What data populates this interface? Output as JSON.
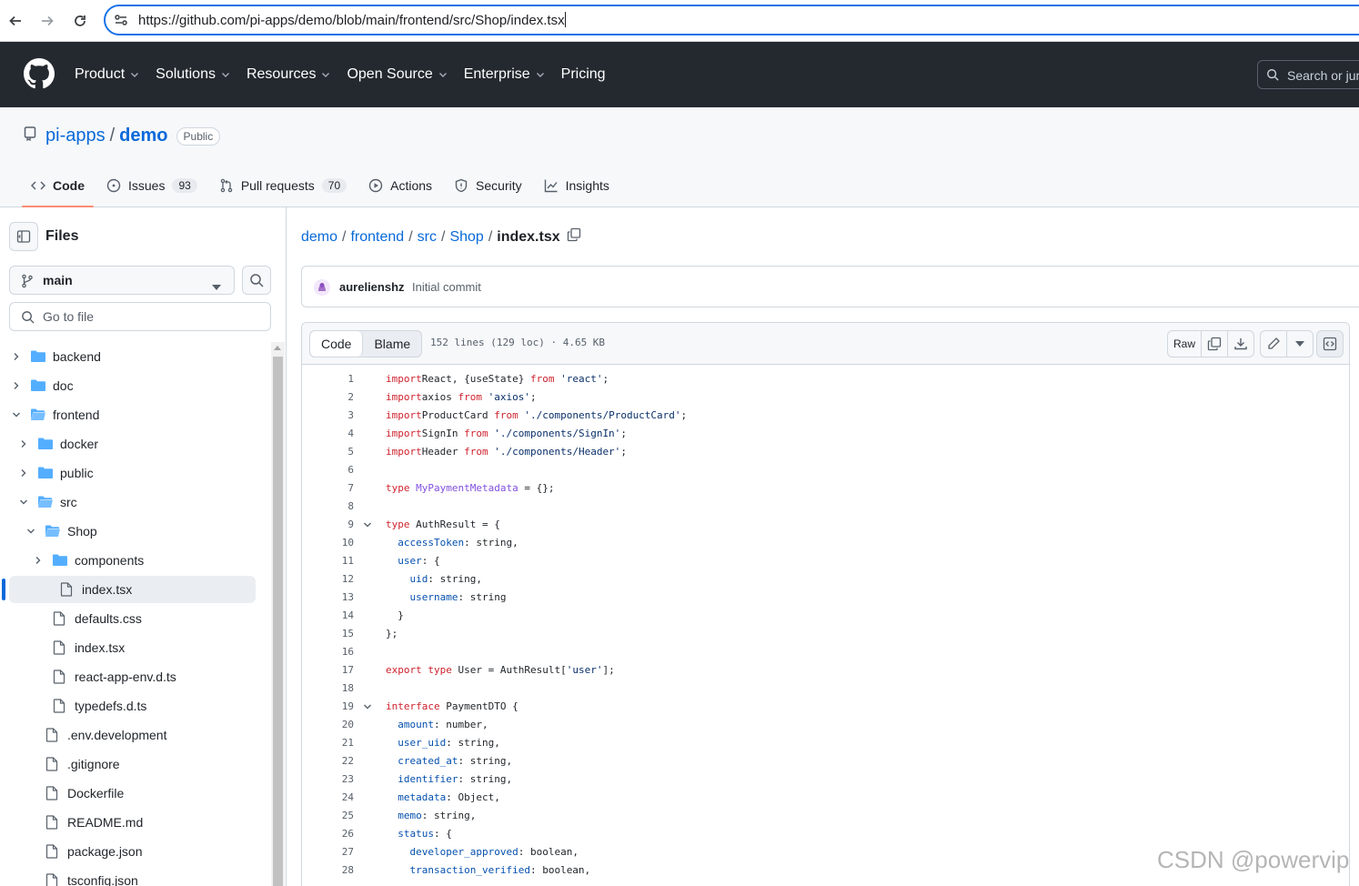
{
  "browser": {
    "url": "https://github.com/pi-apps/demo/blob/main/frontend/src/Shop/index.tsx"
  },
  "gh_header": {
    "nav": [
      "Product",
      "Solutions",
      "Resources",
      "Open Source",
      "Enterprise",
      "Pricing"
    ],
    "nav_has_dropdown": [
      true,
      true,
      true,
      true,
      true,
      false
    ],
    "search_placeholder": "Search or jump to..."
  },
  "repo": {
    "owner": "pi-apps",
    "separator": "/",
    "name": "demo",
    "visibility": "Public",
    "tabs": [
      {
        "label": "Code",
        "icon": "code-icon",
        "selected": true
      },
      {
        "label": "Issues",
        "icon": "issue-icon",
        "count": "93"
      },
      {
        "label": "Pull requests",
        "icon": "pull-request-icon",
        "count": "70"
      },
      {
        "label": "Actions",
        "icon": "play-icon"
      },
      {
        "label": "Security",
        "icon": "shield-icon"
      },
      {
        "label": "Insights",
        "icon": "graph-icon"
      }
    ]
  },
  "sidebar": {
    "title": "Files",
    "branch": "main",
    "goto_placeholder": "Go to file",
    "tree": [
      {
        "label": "backend",
        "type": "folder",
        "depth": 0,
        "expanded": false
      },
      {
        "label": "doc",
        "type": "folder",
        "depth": 0,
        "expanded": false
      },
      {
        "label": "frontend",
        "type": "folder",
        "depth": 0,
        "expanded": true
      },
      {
        "label": "docker",
        "type": "folder",
        "depth": 1,
        "expanded": false
      },
      {
        "label": "public",
        "type": "folder",
        "depth": 1,
        "expanded": false
      },
      {
        "label": "src",
        "type": "folder",
        "depth": 1,
        "expanded": true
      },
      {
        "label": "Shop",
        "type": "folder",
        "depth": 2,
        "expanded": true
      },
      {
        "label": "components",
        "type": "folder",
        "depth": 3,
        "expanded": false
      },
      {
        "label": "index.tsx",
        "type": "file",
        "depth": 3,
        "active": true
      },
      {
        "label": "defaults.css",
        "type": "file",
        "depth": 2
      },
      {
        "label": "index.tsx",
        "type": "file",
        "depth": 2
      },
      {
        "label": "react-app-env.d.ts",
        "type": "file",
        "depth": 2
      },
      {
        "label": "typedefs.d.ts",
        "type": "file",
        "depth": 2
      },
      {
        "label": ".env.development",
        "type": "file",
        "depth": 1
      },
      {
        "label": ".gitignore",
        "type": "file",
        "depth": 1
      },
      {
        "label": "Dockerfile",
        "type": "file",
        "depth": 1
      },
      {
        "label": "README.md",
        "type": "file",
        "depth": 1
      },
      {
        "label": "package.json",
        "type": "file",
        "depth": 1
      },
      {
        "label": "tsconfig.json",
        "type": "file",
        "depth": 1
      }
    ]
  },
  "breadcrumb": {
    "parts": [
      "demo",
      "frontend",
      "src",
      "Shop"
    ],
    "current": "index.tsx"
  },
  "commit": {
    "author": "aurelienshz",
    "message": "Initial commit"
  },
  "file": {
    "tab_code": "Code",
    "tab_blame": "Blame",
    "meta": "152 lines (129 loc) · 4.65 KB",
    "raw_label": "Raw",
    "lines": [
      {
        "n": "1",
        "t": [
          [
            "kw",
            "import"
          ],
          [
            "",
            "React, {useState} "
          ],
          [
            "kw",
            "from"
          ],
          [
            "str",
            " 'react'"
          ],
          [
            "",
            ";"
          ]
        ]
      },
      {
        "n": "2",
        "t": [
          [
            "kw",
            "import"
          ],
          [
            "",
            "axios "
          ],
          [
            "kw",
            "from"
          ],
          [
            "str",
            " 'axios'"
          ],
          [
            "",
            ";"
          ]
        ]
      },
      {
        "n": "3",
        "t": [
          [
            "kw",
            "import"
          ],
          [
            "",
            "ProductCard "
          ],
          [
            "kw",
            "from"
          ],
          [
            "str",
            " './components/ProductCard'"
          ],
          [
            "",
            ";"
          ]
        ]
      },
      {
        "n": "4",
        "t": [
          [
            "kw",
            "import"
          ],
          [
            "",
            "SignIn "
          ],
          [
            "kw",
            "from"
          ],
          [
            "str",
            " './components/SignIn'"
          ],
          [
            "",
            ";"
          ]
        ]
      },
      {
        "n": "5",
        "t": [
          [
            "kw",
            "import"
          ],
          [
            "",
            "Header "
          ],
          [
            "kw",
            "from"
          ],
          [
            "str",
            " './components/Header'"
          ],
          [
            "",
            ";"
          ]
        ]
      },
      {
        "n": "6",
        "t": []
      },
      {
        "n": "7",
        "t": [
          [
            "kw",
            "type"
          ],
          [
            "fn",
            " MyPaymentMetadata"
          ],
          [
            "",
            " = {};"
          ]
        ]
      },
      {
        "n": "8",
        "t": []
      },
      {
        "n": "9",
        "fold": true,
        "t": [
          [
            "kw",
            "type"
          ],
          [
            "",
            " AuthResult = {"
          ]
        ]
      },
      {
        "n": "10",
        "t": [
          [
            "",
            "  "
          ],
          [
            "prop",
            "accessToken"
          ],
          [
            "",
            ": string,"
          ]
        ]
      },
      {
        "n": "11",
        "t": [
          [
            "",
            "  "
          ],
          [
            "prop",
            "user"
          ],
          [
            "",
            ": {"
          ]
        ]
      },
      {
        "n": "12",
        "t": [
          [
            "",
            "    "
          ],
          [
            "prop",
            "uid"
          ],
          [
            "",
            ": string,"
          ]
        ]
      },
      {
        "n": "13",
        "t": [
          [
            "",
            "    "
          ],
          [
            "prop",
            "username"
          ],
          [
            "",
            ": string"
          ]
        ]
      },
      {
        "n": "14",
        "t": [
          [
            "",
            "  }"
          ]
        ]
      },
      {
        "n": "15",
        "t": [
          [
            "",
            "};"
          ]
        ]
      },
      {
        "n": "16",
        "t": []
      },
      {
        "n": "17",
        "t": [
          [
            "kw",
            "export"
          ],
          [
            "",
            ""
          ],
          [
            "kw",
            " type"
          ],
          [
            "",
            " User = AuthResult["
          ],
          [
            "str",
            "'user'"
          ],
          [
            "",
            "];"
          ]
        ]
      },
      {
        "n": "18",
        "t": []
      },
      {
        "n": "19",
        "fold": true,
        "t": [
          [
            "kw",
            "interface"
          ],
          [
            "",
            " PaymentDTO {"
          ]
        ]
      },
      {
        "n": "20",
        "t": [
          [
            "",
            "  "
          ],
          [
            "prop",
            "amount"
          ],
          [
            "",
            ": number,"
          ]
        ]
      },
      {
        "n": "21",
        "t": [
          [
            "",
            "  "
          ],
          [
            "prop",
            "user_uid"
          ],
          [
            "",
            ": string,"
          ]
        ]
      },
      {
        "n": "22",
        "t": [
          [
            "",
            "  "
          ],
          [
            "prop",
            "created_at"
          ],
          [
            "",
            ": string,"
          ]
        ]
      },
      {
        "n": "23",
        "t": [
          [
            "",
            "  "
          ],
          [
            "prop",
            "identifier"
          ],
          [
            "",
            ": string,"
          ]
        ]
      },
      {
        "n": "24",
        "t": [
          [
            "",
            "  "
          ],
          [
            "prop",
            "metadata"
          ],
          [
            "",
            ": Object,"
          ]
        ]
      },
      {
        "n": "25",
        "t": [
          [
            "",
            "  "
          ],
          [
            "prop",
            "memo"
          ],
          [
            "",
            ": string,"
          ]
        ]
      },
      {
        "n": "26",
        "t": [
          [
            "",
            "  "
          ],
          [
            "prop",
            "status"
          ],
          [
            "",
            ": {"
          ]
        ]
      },
      {
        "n": "27",
        "t": [
          [
            "",
            "    "
          ],
          [
            "prop",
            "developer_approved"
          ],
          [
            "",
            ": boolean,"
          ]
        ]
      },
      {
        "n": "28",
        "t": [
          [
            "",
            "    "
          ],
          [
            "prop",
            "transaction_verified"
          ],
          [
            "",
            ": boolean,"
          ]
        ]
      }
    ]
  },
  "watermark": "CSDN @powervip",
  "colors": {
    "header_bg": "#24292f",
    "link": "#0969da",
    "keyword": "#cf222e",
    "string": "#0a3069",
    "property": "#0550ae",
    "folder": "#54aeff"
  }
}
